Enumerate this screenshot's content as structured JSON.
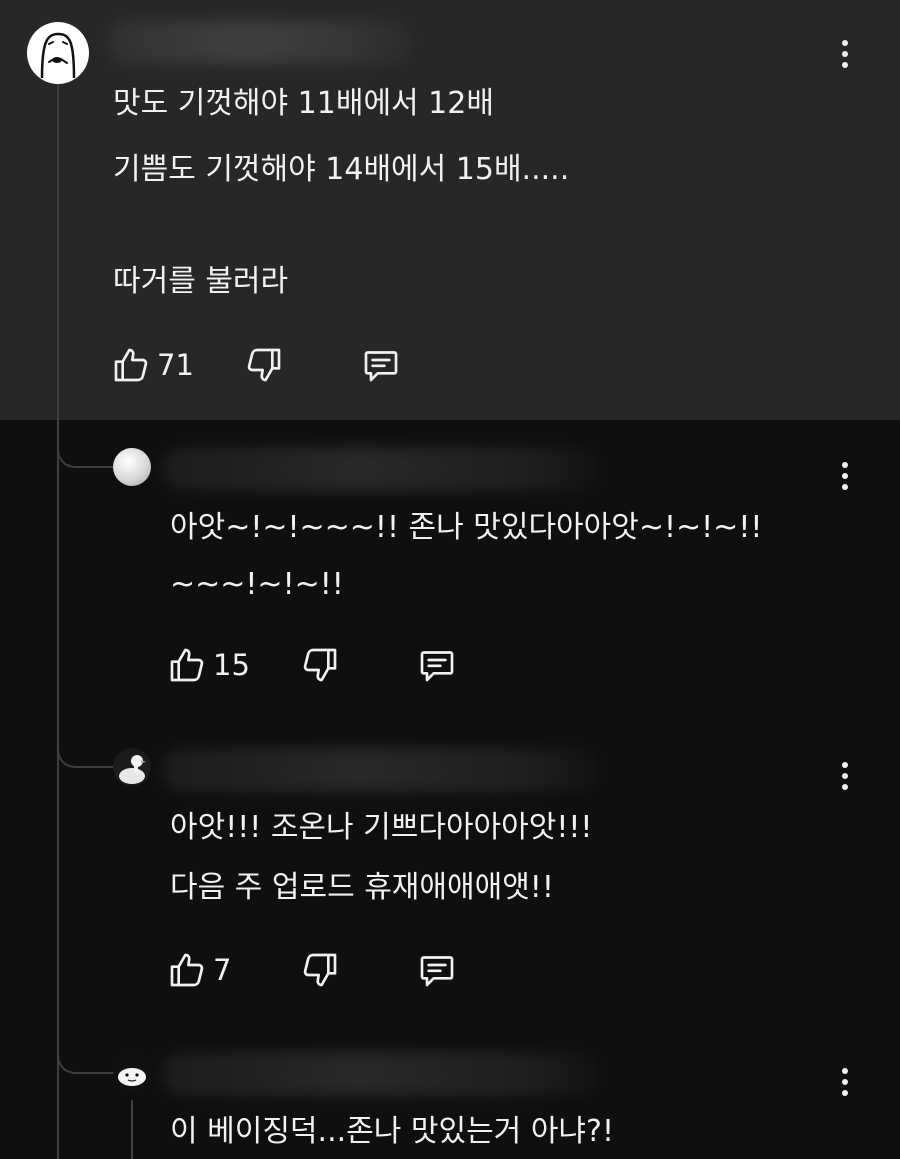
{
  "comment": {
    "lines": [
      "맛도 기껏해야 11배에서 12배",
      "기쁨도 기껏해야 14배에서 15배.....",
      "",
      "따거를 불러라"
    ],
    "likes": "71"
  },
  "replies": [
    {
      "lines": [
        "아앗~!~!~~~!! 존나 맛있다아아앗~!~!~!!",
        "~~~!~!~!!"
      ],
      "likes": "15"
    },
    {
      "lines": [
        "아앗!!! 조온나 기쁘다아아아앗!!!",
        "다음 주 업로드 휴재애애애앳!!"
      ],
      "likes": "7"
    },
    {
      "lines": [
        "이 베이징덕...존나 맛있는거 아냐?!"
      ]
    }
  ],
  "icons": {
    "like": "thumbs-up-icon",
    "dislike": "thumbs-down-icon",
    "reply": "reply-comment-icon",
    "more": "more-vertical-icon"
  },
  "colors": {
    "background": "#0f0f0f",
    "highlight": "#272727",
    "text": "#f1f1f1",
    "thread_line": "#3f3f3f"
  }
}
